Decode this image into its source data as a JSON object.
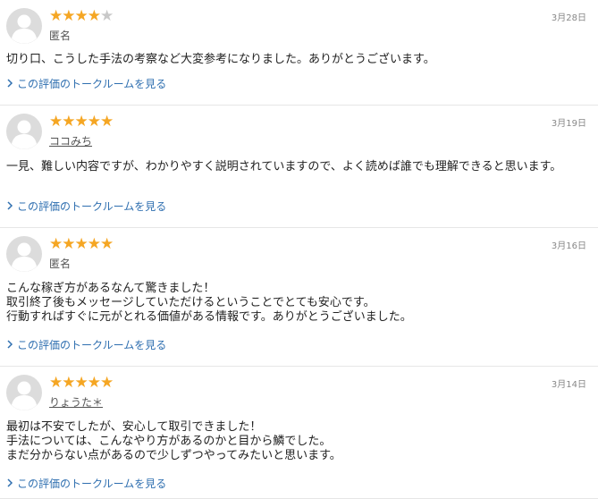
{
  "reviews": [
    {
      "rating": 4,
      "reviewer": "匿名",
      "reviewer_linked": false,
      "date": "3月28日",
      "lines": [
        "切り口、こうした手法の考察など大変参考になりました。ありがとうございます。"
      ],
      "link_text": "この評価のトークルームを見る"
    },
    {
      "rating": 5,
      "reviewer": "ココみち",
      "reviewer_linked": true,
      "date": "3月19日",
      "lines": [
        "一見、難しい内容ですが、わかりやすく説明されていますので、よく読めば誰でも理解できると思います。"
      ],
      "link_text": "この評価のトークルームを見る"
    },
    {
      "rating": 5,
      "reviewer": "匿名",
      "reviewer_linked": false,
      "date": "3月16日",
      "lines": [
        "こんな稼ぎ方があるなんて驚きました！",
        "取引終了後もメッセージしていただけるということでとても安心です。",
        "行動すればすぐに元がとれる価値がある情報です。ありがとうございました。"
      ],
      "link_text": "この評価のトークルームを見る"
    },
    {
      "rating": 5,
      "reviewer": "りょうた＊",
      "reviewer_linked": true,
      "date": "3月14日",
      "lines": [
        "最初は不安でしたが、安心して取引できました！",
        "手法については、こんなやり方があるのかと目から鱗でした。",
        "まだ分からない点があるので少しずつやってみたいと思います。"
      ],
      "link_text": "この評価のトークルームを見る"
    }
  ],
  "icons": {
    "avatar": "user-avatar-icon",
    "star": "star-icon",
    "link": "chevron-right-icon"
  },
  "colors": {
    "star_filled": "#f5a623",
    "star_empty": "#c8c8c8",
    "link": "#2f6fb0",
    "divider": "#e6e6e6"
  }
}
